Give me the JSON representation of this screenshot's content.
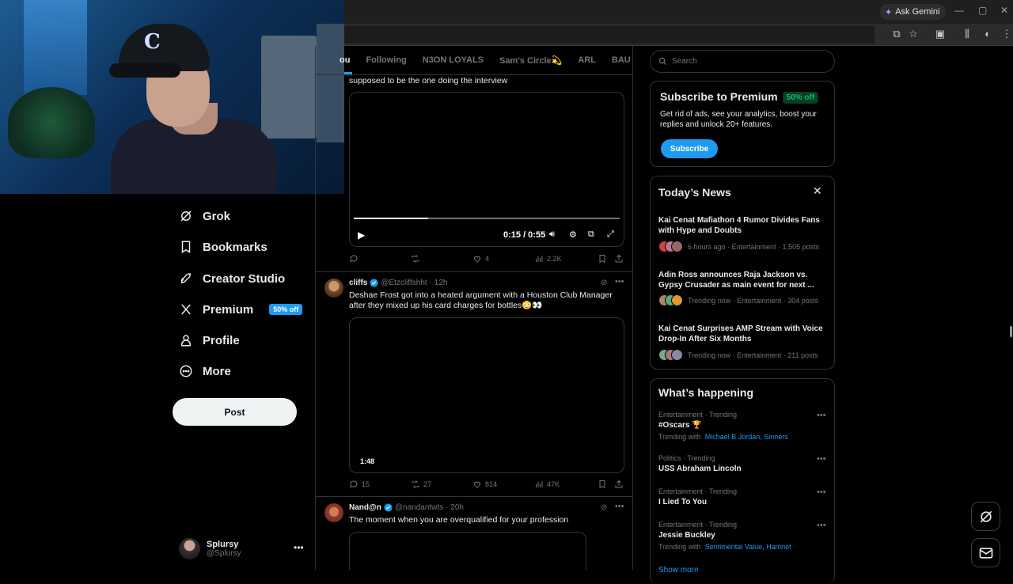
{
  "browser": {
    "ask_gemini": "Ask Gemini"
  },
  "nav": {
    "items": [
      {
        "label": "Grok",
        "icon": "grok-icon"
      },
      {
        "label": "Bookmarks",
        "icon": "bookmark-icon"
      },
      {
        "label": "Creator Studio",
        "icon": "rocket-icon"
      },
      {
        "label": "Premium",
        "icon": "x-logo-icon",
        "badge": "50% off"
      },
      {
        "label": "Profile",
        "icon": "person-icon"
      },
      {
        "label": "More",
        "icon": "more-circle-icon"
      }
    ],
    "post_label": "Post",
    "account": {
      "name": "Splursy",
      "handle": "@Splursy"
    }
  },
  "feed": {
    "tabs": [
      "ou",
      "Following",
      "N3ON LOYALS",
      "Sam's Circle💫",
      "ARL",
      "BAU"
    ],
    "posts": [
      {
        "text": "supposed to be the one doing the interview",
        "video": {
          "time": "0:15 / 0:55",
          "progress": 0.28
        },
        "actions": {
          "replies": "",
          "reposts": "",
          "likes": "4",
          "views": "2.2K"
        }
      },
      {
        "name": "cliffs",
        "handle": "@Etzcliffshht",
        "time": "· 12h",
        "text_line1": "Deshae Frost got into a heated argument with a Houston Club Manager",
        "text_line2": "after they mixed up his card charges for bottles😳👀",
        "video": {
          "duration": "1:48"
        },
        "actions": {
          "replies": "15",
          "reposts": "27",
          "likes": "814",
          "views": "47K"
        }
      },
      {
        "name": "Nand@n",
        "handle": "@nandantwts",
        "time": "· 20h",
        "text": "The moment when you are overqualified for your profession"
      }
    ]
  },
  "sidebar": {
    "search_placeholder": "Search",
    "premium": {
      "title": "Subscribe to Premium",
      "discount": "50% off",
      "body_line1": "Get rid of ads, see your analytics, boost your",
      "body_line2": "replies and unlock 20+ features.",
      "button": "Subscribe"
    },
    "news": {
      "title": "Today’s News",
      "items": [
        {
          "line1": "Kai Cenat Mafiathon 4 Rumor Divides Fans",
          "line2": "with Hype and Doubts",
          "meta": "6 hours ago · Entertainment · 1,505 posts"
        },
        {
          "line1": "Adin Ross announces Raja Jackson vs.",
          "line2": "Gypsy Crusader as main event for next ...",
          "meta": "Trending now · Entertainment · 304 posts"
        },
        {
          "line1": "Kai Cenat Surprises AMP Stream with Voice",
          "line2": "Drop-In After Six Months",
          "meta": "Trending now · Entertainment · 211 posts"
        }
      ]
    },
    "happening": {
      "title": "What’s happening",
      "trends": [
        {
          "category": "Entertainment · Trending",
          "name": "#Oscars 🏆",
          "with_prefix": "Trending with",
          "with_links": "Michael B Jordan, Sinners"
        },
        {
          "category": "Politics · Trending",
          "name": "USS Abraham Lincoln"
        },
        {
          "category": "Entertainment · Trending",
          "name": "I Lied To You"
        },
        {
          "category": "Entertainment · Trending",
          "name": "Jessie Buckley",
          "with_prefix": "Trending with",
          "with_links": "Sentimental Value, Hamnet"
        }
      ],
      "show_more": "Show more"
    }
  },
  "colors": {
    "accent": "#1d9bf0",
    "background": "#000000",
    "border": "#2f3336",
    "muted": "#71767b",
    "green": "#00ba7c"
  }
}
